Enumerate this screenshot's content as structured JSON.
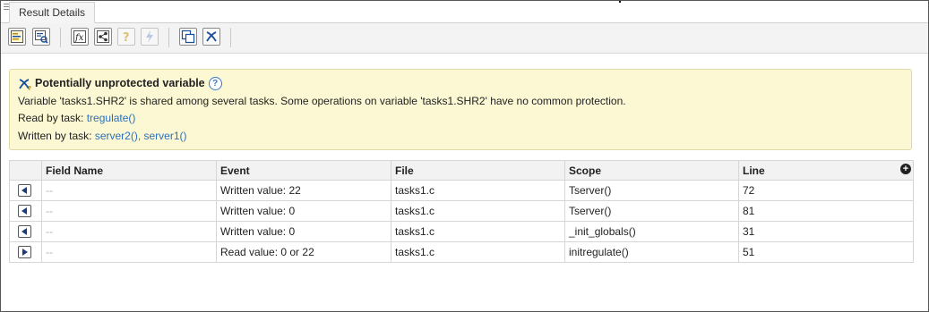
{
  "window": {
    "tab_label": "Result Details"
  },
  "toolbar": {
    "buttons": [
      {
        "icon": "source-code-icon",
        "enabled": true
      },
      {
        "icon": "review-icon",
        "enabled": true
      },
      {
        "icon": "fx-function-icon",
        "enabled": true
      },
      {
        "icon": "share-icon",
        "enabled": true
      },
      {
        "icon": "help-icon",
        "enabled": false
      },
      {
        "icon": "lightning-icon",
        "enabled": false
      },
      {
        "icon": "copy-icon",
        "enabled": true
      },
      {
        "icon": "variable-x-icon",
        "enabled": true
      }
    ]
  },
  "result": {
    "title": "Potentially unprotected variable",
    "description": "Variable 'tasks1.SHR2' is shared among several tasks. Some operations on variable 'tasks1.SHR2' have no common protection.",
    "read_label": "Read by task:",
    "read_tasks": "tregulate()",
    "written_label": "Written by task:",
    "written_tasks": "server2(), server1()"
  },
  "table": {
    "columns": [
      "",
      "Field Name",
      "Event",
      "File",
      "Scope",
      "Line"
    ],
    "rows": [
      {
        "direction": "left",
        "field": "--",
        "event": "Written value: 22",
        "file": "tasks1.c",
        "scope": "Tserver()",
        "line": "72"
      },
      {
        "direction": "left",
        "field": "--",
        "event": "Written value: 0",
        "file": "tasks1.c",
        "scope": "Tserver()",
        "line": "81"
      },
      {
        "direction": "left",
        "field": "--",
        "event": "Written value: 0",
        "file": "tasks1.c",
        "scope": "_init_globals()",
        "line": "31"
      },
      {
        "direction": "right",
        "field": "--",
        "event": "Read value: 0 or 22",
        "file": "tasks1.c",
        "scope": "initregulate()",
        "line": "51"
      }
    ]
  },
  "colors": {
    "info_bg": "#fbf8d3",
    "link": "#2c6fbd",
    "icon_blue": "#1a4e9a"
  }
}
